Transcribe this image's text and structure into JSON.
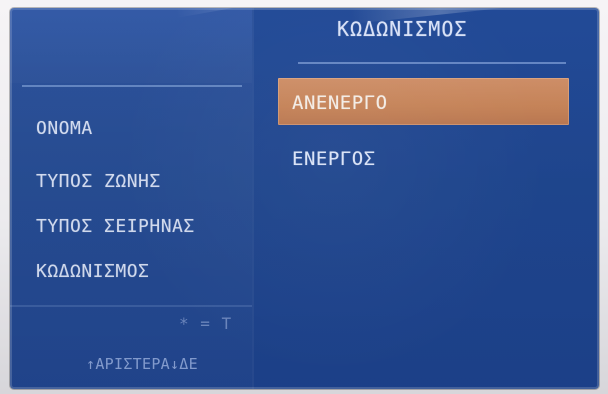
{
  "window": {
    "title": "ΚΩΔΩΝΙΣΜΟΣ"
  },
  "left_menu": {
    "items": [
      {
        "label": "ΟΝΟΜΑ"
      },
      {
        "label": "ΤΥΠΟΣ ΖΩΝΗΣ"
      },
      {
        "label": "ΤΥΠΟΣ ΣΕΙΡΗΝΑΣ"
      },
      {
        "label": "ΚΩΔΩΝΙΣΜΟΣ"
      }
    ]
  },
  "options": {
    "items": [
      {
        "label": "ΑΝΕΝΕΡΓΟ",
        "selected": true
      },
      {
        "label": "ΕΝΕΡΓΟΣ",
        "selected": false
      }
    ]
  },
  "footer": {
    "hint": "* = Τ",
    "nav": "↑ΑΡΙΣΤΕΡΑ↓ΔΕ"
  },
  "colors": {
    "screen_background": "#224a97",
    "selection_highlight": "#c78459",
    "text_primary": "#dde6fb"
  }
}
